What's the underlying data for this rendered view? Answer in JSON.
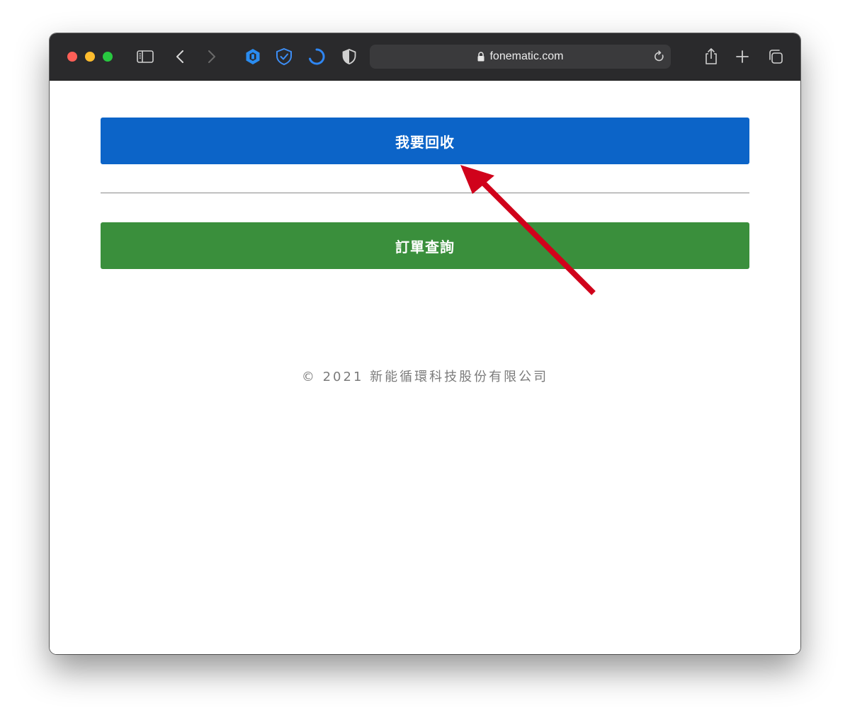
{
  "browser": {
    "url": "fonematic.com",
    "icons": [
      "sidebar-icon",
      "back-icon",
      "forward-icon",
      "extension-hex-icon",
      "shield-check-icon",
      "loading-spinner-icon",
      "privacy-shield-icon",
      "lock-icon",
      "reload-icon",
      "share-icon",
      "new-tab-icon",
      "tabs-overview-icon"
    ]
  },
  "page": {
    "primary_button_label": "我要回收",
    "secondary_button_label": "訂單查詢",
    "footer_text": "© 2021 新能循環科技股份有限公司"
  },
  "colors": {
    "primary_button": "#0c64c8",
    "secondary_button": "#3a8f3c",
    "annotation_arrow": "#d0021b",
    "toolbar": "#2a2a2c"
  }
}
